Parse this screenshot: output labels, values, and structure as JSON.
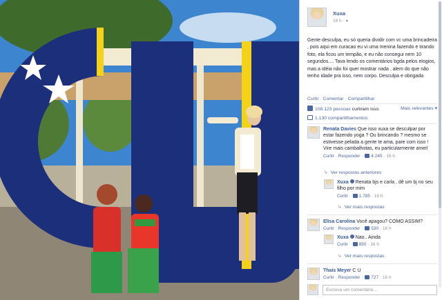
{
  "post": {
    "author": "Xuxa",
    "time": "16 h",
    "text": "Gente desculpa, eu só queria dividir com vc uma brincadeira , pois aqui em curacao eu vi uma menina fazendo e tirando foto, ela ficou um tempão, e eu não consegui nem 10 segundos.... Tava lendo os comentários bgda pelos elogios, mas a idéia não foi quer mostrar nada , alem do que não tenho idade pra isso, nem corpo. Desculpa e obrigada"
  },
  "actions": {
    "like": "Curtir",
    "comment": "Comentar",
    "share": "Compartilhar",
    "sep": "·"
  },
  "stats": {
    "likes_count": "108.123 pessoas",
    "likes_suffix": "curtiram isso.",
    "relevance": "Mais relevantes ▾",
    "shares": "1.130 compartilhamentos"
  },
  "comments": [
    {
      "author": "Renata Davies",
      "text": "Que isso xuxa se desculpar por estar fazendo yoga ? Ou brincando ? mesmo se estivesse pelada a gente te ama, pare com isso ! Vire mais cambalhotas, eu particularmente amei!",
      "like": "Curtir",
      "reply": "Responder",
      "likes": "4.245",
      "time": "16 h",
      "prev_replies": "Ver respostas anteriores",
      "reply_item": {
        "author": "Xuxa",
        "text": "Renata bjs e carla , dê um bj no seu filho por mim",
        "like": "Curtir",
        "likes": "1.785",
        "time": "16 h"
      },
      "more_replies": "Ver mais respostas"
    },
    {
      "author": "Elisa Carolina",
      "text": "Você apagou? COMO ASSIM?",
      "like": "Curtir",
      "reply": "Responder",
      "likes": "530",
      "time": "16 h",
      "reply_item": {
        "author": "Xuxa",
        "text": "Nao.. Ainda",
        "like": "Curtir",
        "likes": "850",
        "time": "16 h"
      },
      "more_replies": "Ver mais respostas"
    },
    {
      "author": "Thais Meyer",
      "text": "C U",
      "like": "Curtir",
      "reply": "Responder",
      "likes": "727",
      "time": "16 h"
    }
  ],
  "composer": {
    "placeholder": "Escreva um comentário..."
  },
  "photo": {
    "letters": "CU",
    "colors": {
      "navy": "#1b2f7a",
      "yellow": "#f4d21a",
      "sky": "#2f7cc9"
    }
  }
}
